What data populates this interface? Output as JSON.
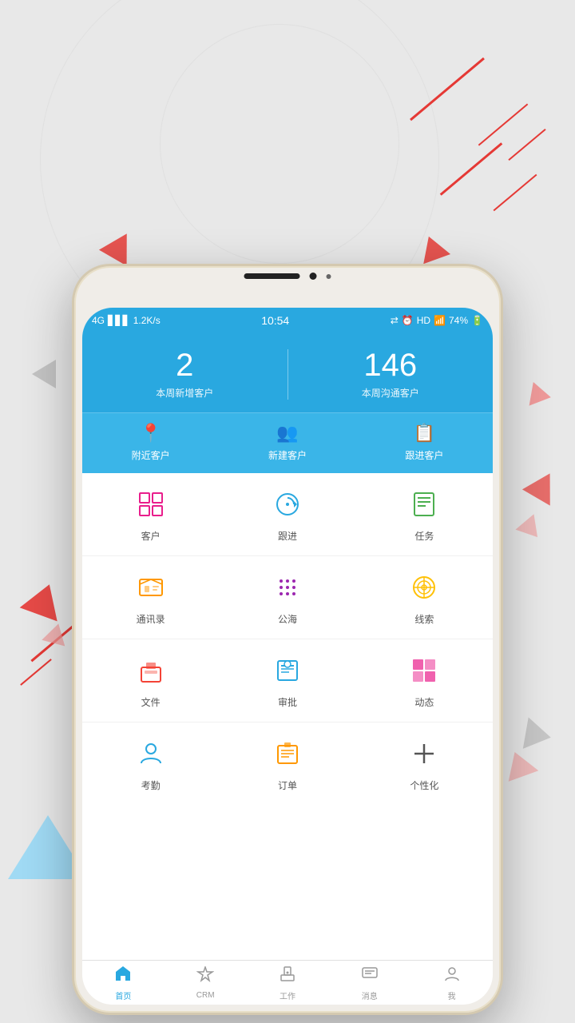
{
  "background": {
    "color": "#e8e8e8"
  },
  "statusBar": {
    "network": "4G",
    "signal": "|||",
    "speed": "1.2K/s",
    "time": "10:54",
    "batteryPercent": "74%"
  },
  "header": {
    "stats": [
      {
        "number": "2",
        "label": "本周新增客户"
      },
      {
        "number": "146",
        "label": "本周沟通客户"
      }
    ]
  },
  "quickActions": [
    {
      "label": "附近客户",
      "icon": "📍"
    },
    {
      "label": "新建客户",
      "icon": "👥"
    },
    {
      "label": "跟进客户",
      "icon": "📋"
    }
  ],
  "menuRows": [
    [
      {
        "label": "客户",
        "icon": "🏢",
        "color": "#e91e8c"
      },
      {
        "label": "跟进",
        "icon": "🔄",
        "color": "#29a8e0"
      },
      {
        "label": "任务",
        "icon": "📃",
        "color": "#4caf50"
      }
    ],
    [
      {
        "label": "通讯录",
        "icon": "📖",
        "color": "#ff9800"
      },
      {
        "label": "公海",
        "icon": "⠿",
        "color": "#9c27b0"
      },
      {
        "label": "线索",
        "icon": "🌐",
        "color": "#ffc107"
      }
    ],
    [
      {
        "label": "文件",
        "icon": "💼",
        "color": "#f44336"
      },
      {
        "label": "审批",
        "icon": "📅",
        "color": "#29a8e0"
      },
      {
        "label": "动态",
        "icon": "⊞",
        "color": "#e91e8c"
      }
    ],
    [
      {
        "label": "考勤",
        "icon": "👤",
        "color": "#29a8e0"
      },
      {
        "label": "订单",
        "icon": "📋",
        "color": "#ff9800"
      },
      {
        "label": "个性化",
        "icon": "➕",
        "color": "#555"
      }
    ]
  ],
  "bottomNav": [
    {
      "label": "首页",
      "icon": "🏠",
      "active": true
    },
    {
      "label": "CRM",
      "icon": "🛡",
      "active": false
    },
    {
      "label": "工作",
      "icon": "🔒",
      "active": false
    },
    {
      "label": "消息",
      "icon": "💬",
      "active": false
    },
    {
      "label": "我",
      "icon": "👤",
      "active": false
    }
  ]
}
